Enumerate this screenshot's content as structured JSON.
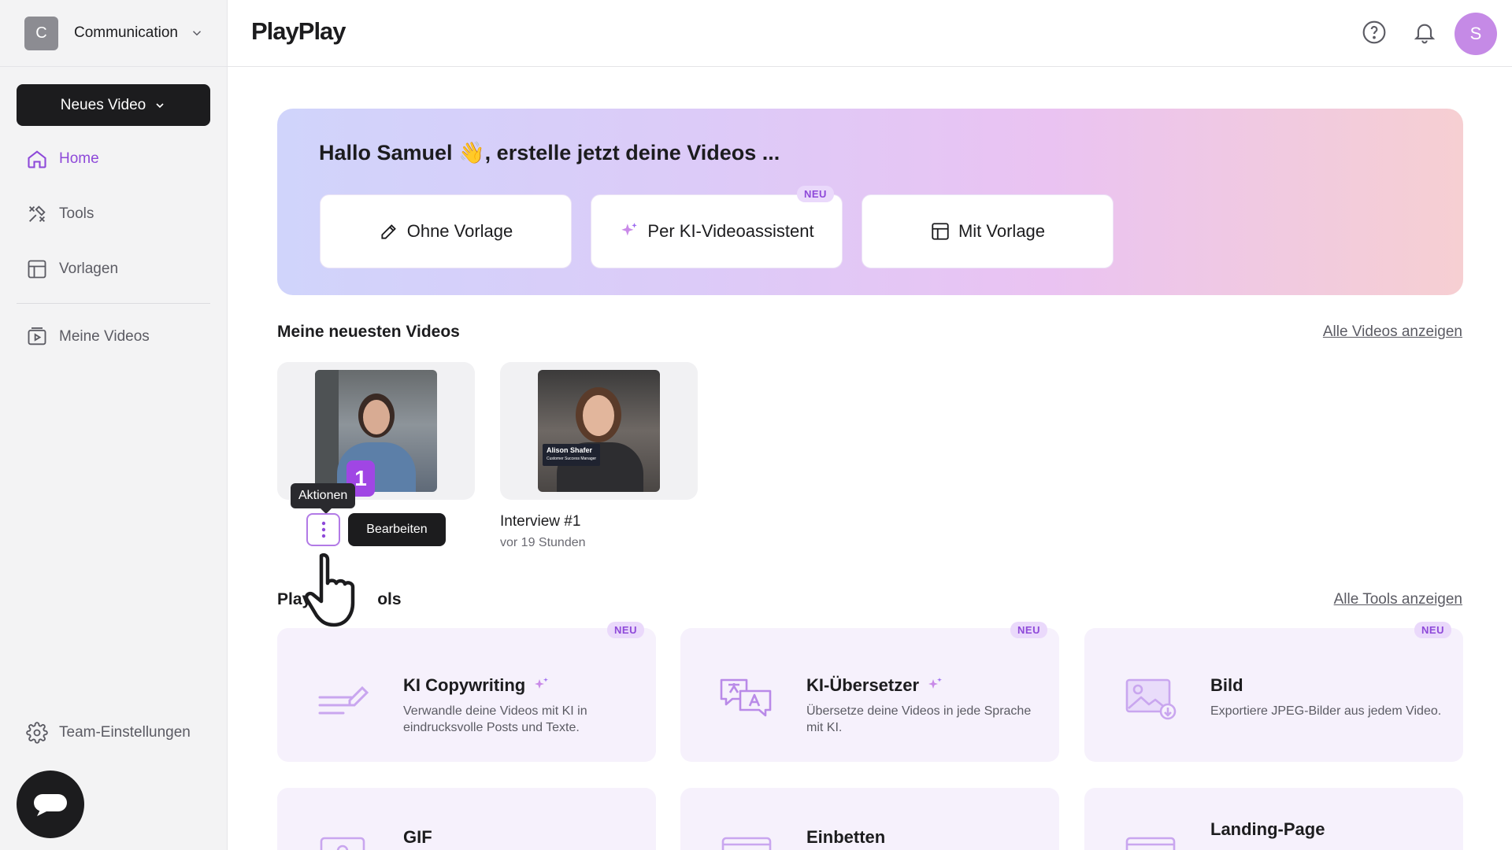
{
  "sidebar": {
    "workspace": {
      "initial": "C",
      "name": "Communication"
    },
    "new_video_label": "Neues Video",
    "nav": [
      {
        "label": "Home",
        "icon": "home-icon",
        "active": true
      },
      {
        "label": "Tools",
        "icon": "tools-icon"
      },
      {
        "label": "Vorlagen",
        "icon": "template-icon"
      },
      {
        "label": "Meine Videos",
        "icon": "video-library-icon"
      }
    ],
    "team_settings_label": "Team-Einstellungen"
  },
  "header": {
    "logo": "PlayPlay",
    "avatar_initial": "S"
  },
  "hero": {
    "title": "Hallo Samuel 👋, erstelle jetzt deine Videos ...",
    "buttons": [
      {
        "label": "Ohne Vorlage",
        "icon": "pencil-icon"
      },
      {
        "label": "Per KI-Videoassistent",
        "icon": "sparkle-icon",
        "badge": "NEU"
      },
      {
        "label": "Mit Vorlage",
        "icon": "template-icon"
      }
    ]
  },
  "videos_section": {
    "title": "Meine neuesten Videos",
    "link": "Alle Videos anzeigen",
    "step_badge": "1",
    "tooltip": "Aktionen",
    "edit_label": "Bearbeiten",
    "videos": [
      {
        "title": "",
        "meta": ""
      },
      {
        "title": "Interview #1",
        "meta": "vor 19 Stunden",
        "name_tag": "Alison Shafer",
        "name_tag_sub": "Customer Success Manager"
      }
    ]
  },
  "tools_section": {
    "title_left": "Play",
    "title_right": "ols",
    "link": "Alle Tools anzeigen",
    "tools": [
      {
        "title": "KI Copywriting",
        "desc": "Verwandle deine Videos mit KI in eindrucksvolle Posts und Texte.",
        "badge": "NEU",
        "icon": "copywriting-icon"
      },
      {
        "title": "KI-Übersetzer",
        "desc": "Übersetze deine Videos in jede Sprache mit KI.",
        "badge": "NEU",
        "icon": "translate-icon"
      },
      {
        "title": "Bild",
        "desc": "Exportiere JPEG-Bilder aus jedem Video.",
        "badge": "NEU",
        "icon": "image-export-icon"
      },
      {
        "title": "GIF",
        "icon": "gif-icon"
      },
      {
        "title": "Einbetten",
        "icon": "embed-icon"
      },
      {
        "title": "Landing-Page",
        "icon": "landing-page-icon"
      }
    ]
  },
  "colors": {
    "accent": "#8e49d9",
    "dark": "#1c1c1e",
    "badge_bg": "#ead9fb"
  }
}
